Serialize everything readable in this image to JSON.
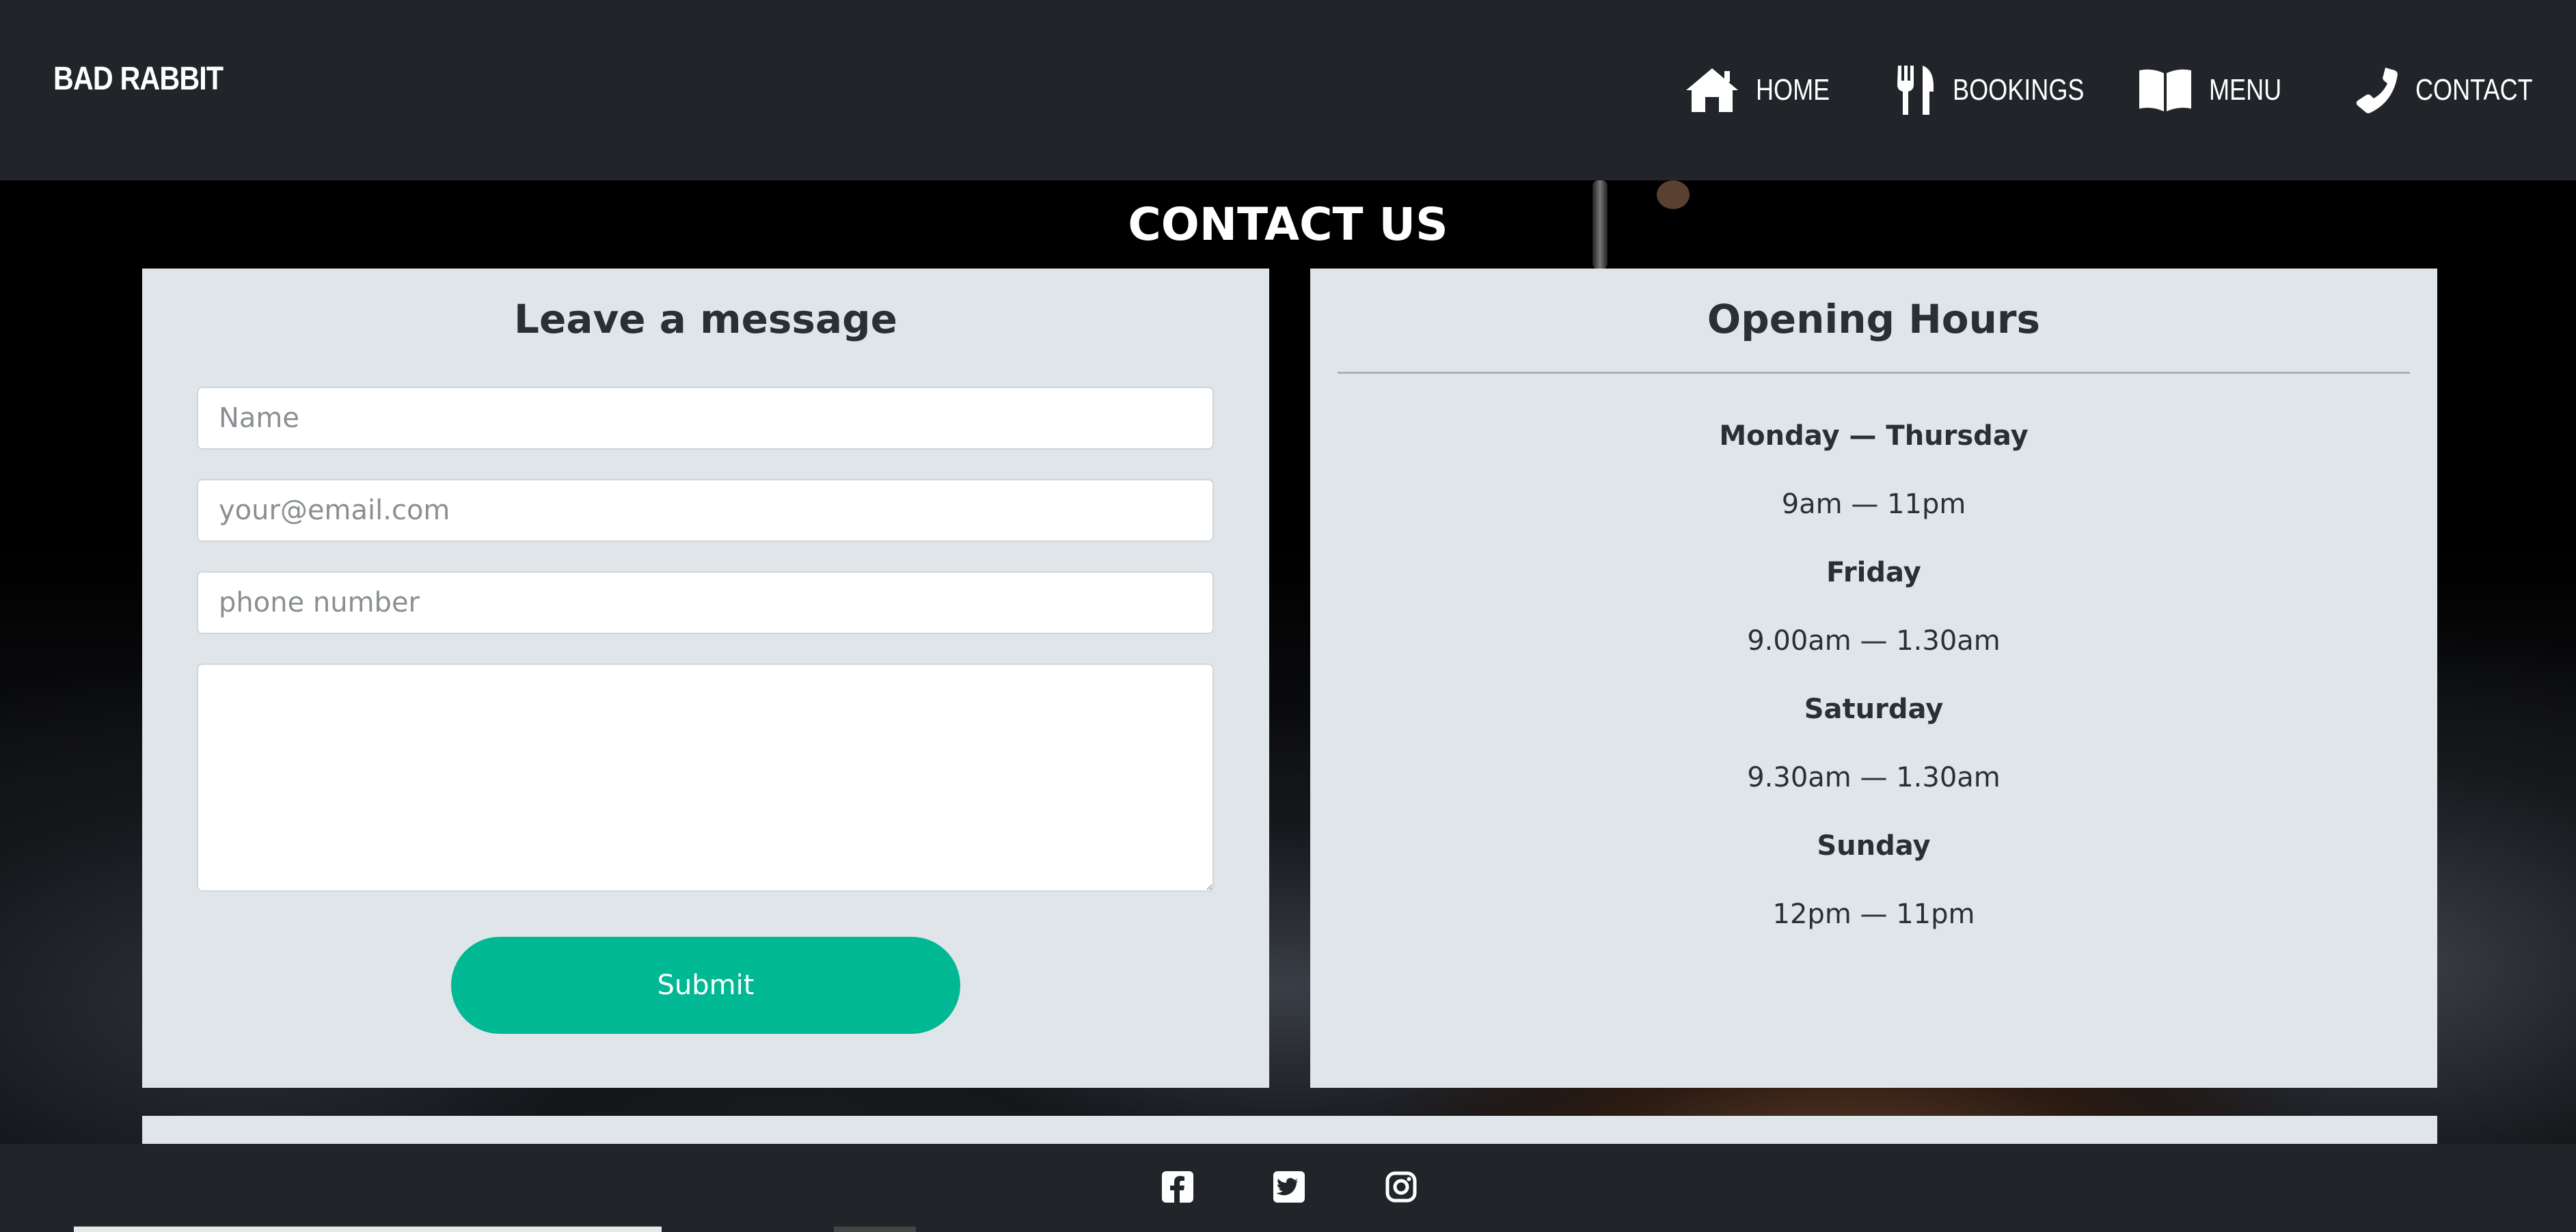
{
  "navbar": {
    "brand": "BAD RABBIT",
    "items": [
      {
        "label": "HOME",
        "icon": "home-icon"
      },
      {
        "label": "BOOKINGS",
        "icon": "utensils-icon"
      },
      {
        "label": "MENU",
        "icon": "book-open-icon"
      },
      {
        "label": "CONTACT",
        "icon": "phone-icon"
      }
    ]
  },
  "page": {
    "title": "CONTACT US"
  },
  "form": {
    "heading": "Leave a message",
    "name_placeholder": "Name",
    "email_placeholder": "your@email.com",
    "phone_placeholder": "phone number",
    "message_placeholder": "",
    "submit_label": "Submit"
  },
  "hours": {
    "heading": "Opening Hours",
    "entries": [
      {
        "day": "Monday — Thursday",
        "time": "9am — 11pm"
      },
      {
        "day": "Friday",
        "time": "9.00am — 1.30am"
      },
      {
        "day": "Saturday",
        "time": "9.30am — 1.30am"
      },
      {
        "day": "Sunday",
        "time": "12pm — 11pm"
      }
    ]
  },
  "footer": {
    "social": [
      "facebook-icon",
      "twitter-icon",
      "instagram-icon"
    ]
  },
  "colors": {
    "nav_bg": "#212429",
    "card_bg": "#dfe5e8",
    "accent": "#00b894"
  }
}
